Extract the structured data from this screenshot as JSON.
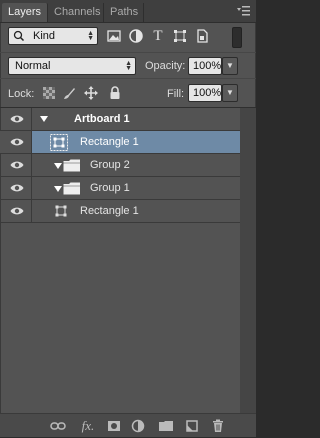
{
  "tabs": [
    {
      "label": "Layers",
      "active": true
    },
    {
      "label": "Channels",
      "active": false
    },
    {
      "label": "Paths",
      "active": false
    }
  ],
  "filter": {
    "kind_label": "Kind",
    "icons": [
      "image-filter-icon",
      "adjustment-filter-icon",
      "type-filter-icon",
      "shape-filter-icon",
      "smart-object-filter-icon"
    ],
    "type_glyph": "T"
  },
  "blend": {
    "mode": "Normal",
    "opacity_label": "Opacity:",
    "opacity_value": "100%"
  },
  "lock": {
    "label": "Lock:",
    "fill_label": "Fill:",
    "fill_value": "100%"
  },
  "layers": [
    {
      "name": "Artboard 1",
      "type": "artboard",
      "expanded": true,
      "selected": false
    },
    {
      "name": "Rectangle 1",
      "type": "shape",
      "selected": true
    },
    {
      "name": "Group 2",
      "type": "group",
      "expanded": true,
      "selected": false
    },
    {
      "name": "Group 1",
      "type": "group",
      "expanded": true,
      "selected": false
    },
    {
      "name": "Rectangle 1",
      "type": "shape",
      "selected": false
    }
  ],
  "bottom_bar": {
    "fx_label": "fx.",
    "icons": [
      "link-layers-icon",
      "fx-icon",
      "layer-mask-icon",
      "adjustment-layer-icon",
      "new-group-icon",
      "new-layer-icon",
      "delete-layer-icon"
    ]
  },
  "colors": {
    "panel_bg": "#535353",
    "selected_row": "#6e8aa6",
    "tab_bar": "#3f3f3f"
  }
}
